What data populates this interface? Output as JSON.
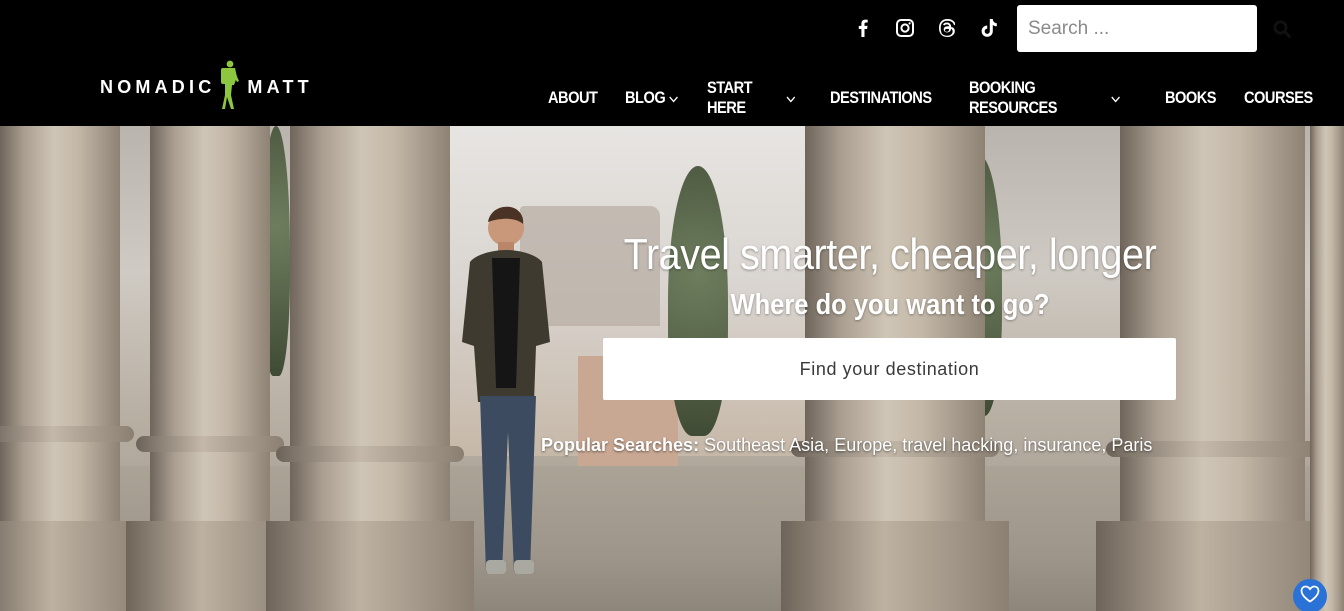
{
  "header": {
    "logo": {
      "left_text": "NOMADIC",
      "right_text": "MATT",
      "accent": "#8dc63f"
    },
    "socials": [
      {
        "name": "facebook-icon"
      },
      {
        "name": "instagram-icon"
      },
      {
        "name": "threads-icon"
      },
      {
        "name": "tiktok-icon"
      }
    ],
    "search": {
      "placeholder": "Search ...",
      "value": ""
    },
    "nav": [
      {
        "label": "About",
        "dropdown": false
      },
      {
        "label": "Blog",
        "dropdown": true
      },
      {
        "label": "Start Here",
        "dropdown": true
      },
      {
        "label": "Destinations",
        "dropdown": false
      },
      {
        "label": "Booking Resources",
        "dropdown": true
      },
      {
        "label": "Books",
        "dropdown": false
      },
      {
        "label": "Courses",
        "dropdown": false
      }
    ]
  },
  "hero": {
    "title": "Travel smarter, cheaper, longer",
    "subtitle": "Where do you want to go?",
    "destination_placeholder": "Find your destination",
    "popular_label": "Popular Searches:",
    "popular": [
      "Southeast Asia",
      "Europe",
      "travel hacking",
      "insurance",
      "Paris"
    ]
  },
  "colors": {
    "header_bg": "#000000",
    "fav_button": "#2a72d6"
  }
}
